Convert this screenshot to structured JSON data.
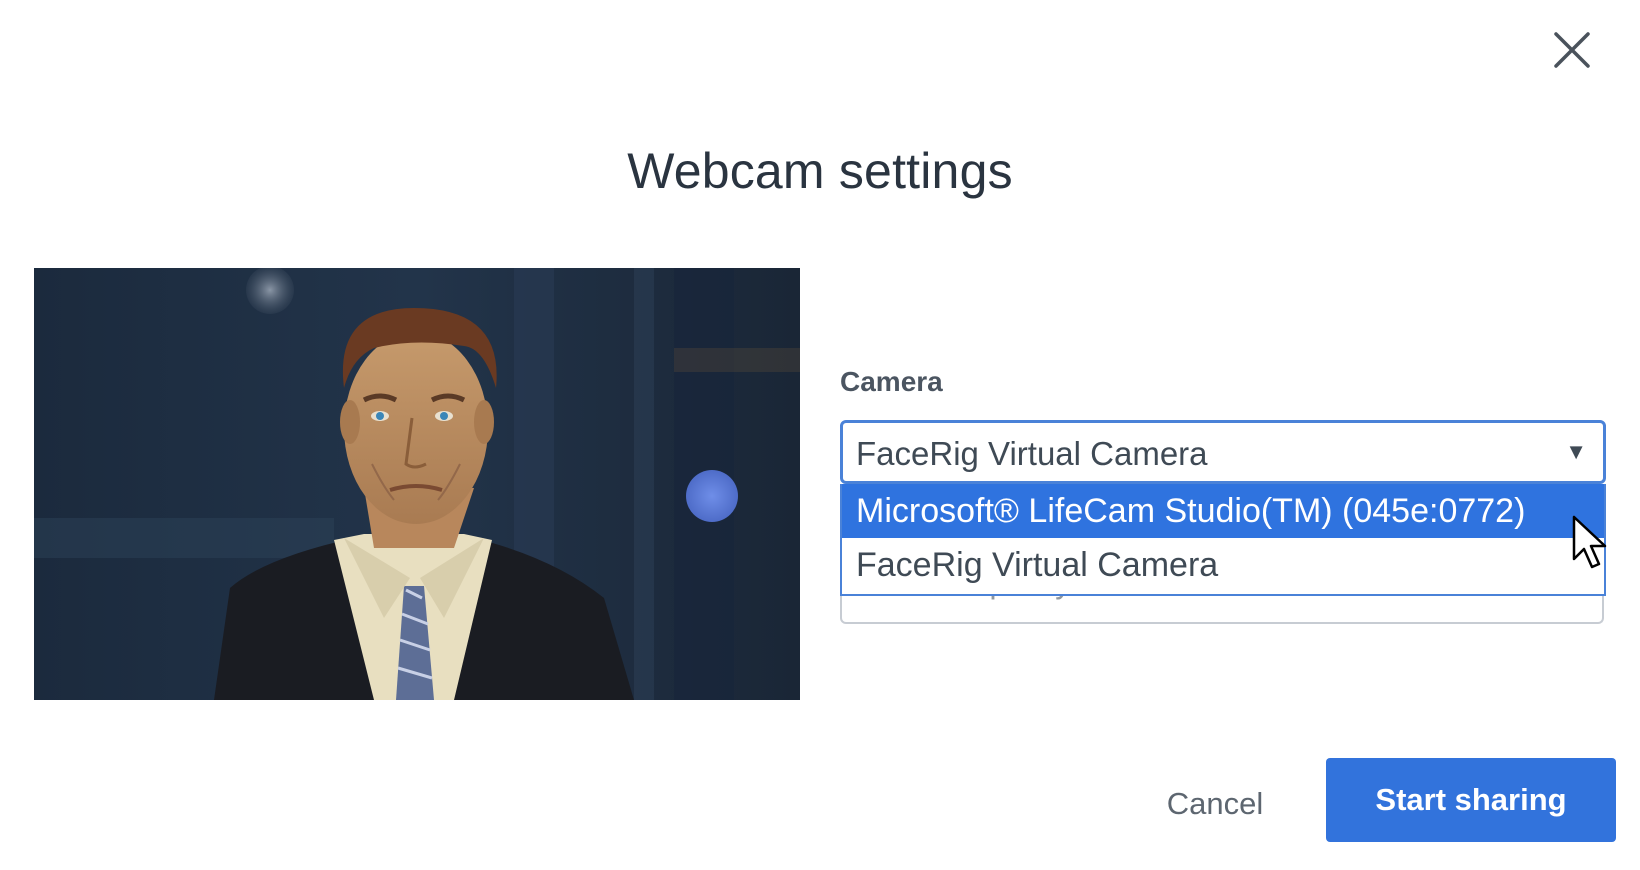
{
  "dialog": {
    "title": "Webcam settings",
    "close_icon": "close-icon"
  },
  "camera": {
    "label": "Camera",
    "selected_value": "FaceRig Virtual Camera",
    "caret": "▼",
    "options": [
      {
        "label": "Microsoft® LifeCam Studio(TM) (045e:0772)",
        "highlighted": true
      },
      {
        "label": "FaceRig Virtual Camera",
        "highlighted": false
      }
    ]
  },
  "quality": {
    "selected_value": "Medium quality",
    "caret": "▼"
  },
  "buttons": {
    "cancel_label": "Cancel",
    "start_label": "Start sharing"
  },
  "preview": {
    "description_icon": "webcam-preview-avatar"
  },
  "colors": {
    "accent": "#3273dc",
    "highlight": "#2f73df",
    "focus_border": "#4a82d8",
    "title_text": "#2a3440"
  }
}
